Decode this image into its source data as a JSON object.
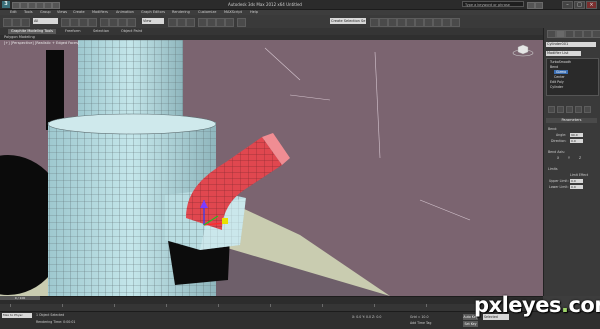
{
  "titlebar": {
    "title": "Autodesk 3ds Max 2012 x64  Untitled",
    "search_placeholder": "Type a keyword or phrase",
    "logo_text": "3",
    "minimize": "–",
    "maximize": "□",
    "close": "×"
  },
  "menu": [
    "Edit",
    "Tools",
    "Group",
    "Views",
    "Create",
    "Modifiers",
    "Animation",
    "Graph Editors",
    "Rendering",
    "Customize",
    "MAXScript",
    "Help"
  ],
  "toolbar": {
    "selection_filter": "All",
    "view_mode": "View",
    "named_selection": "Create Selection Se"
  },
  "ribbon": {
    "tabs": [
      "Graphite Modeling Tools",
      "Freeform",
      "Selection",
      "Object Paint"
    ],
    "subtitle": "Polygon Modeling"
  },
  "viewport": {
    "label": "[+] [Perspective] [Realistic + Edged Faces]"
  },
  "command_panel": {
    "object_name": "Cylinder001",
    "modifier_list": "Modifier List",
    "stack": [
      "TurboSmooth",
      "Bend",
      "Gizmo",
      "Center",
      "Edit Poly",
      "Cylinder"
    ],
    "parameters_header": "Parameters",
    "bend_group": "Bend:",
    "angle_label": "Angle:",
    "angle_value": "90.0",
    "direction_label": "Direction:",
    "direction_value": "0.0",
    "axis_group": "Bend Axis:",
    "axis_options": [
      "X",
      "Y",
      "Z"
    ],
    "limits_group": "Limits",
    "limit_effect": "Limit Effect",
    "upper_label": "Upper Limit:",
    "upper_value": "0.0",
    "lower_label": "Lower Limit:",
    "lower_value": "0.0"
  },
  "timeline": {
    "slider": "0 / 100",
    "ticks": [
      "0",
      "10",
      "20",
      "30",
      "40",
      "50",
      "60",
      "70",
      "80",
      "90",
      "100"
    ]
  },
  "status": {
    "maxscript": "Max to Physc",
    "line1": "1 Object Selected",
    "line2": "Rendering Time: 0:00:01",
    "coords": "X: 0.0  Y: 0.0  Z: 0.0",
    "grid": "Grid = 10.0",
    "add_time_tag": "Add Time Tag",
    "auto_key": "Auto Key",
    "set_key": "Set Key",
    "selected": "Selected"
  },
  "watermark": {
    "text_a": "pxleyes",
    "dot": ".",
    "text_b": "com"
  }
}
